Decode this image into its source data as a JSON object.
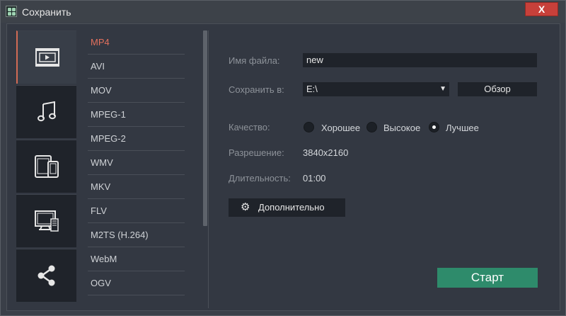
{
  "window": {
    "title": "Сохранить",
    "close_label": "X"
  },
  "categories": [
    {
      "name": "video",
      "icon": "film-icon",
      "active": true
    },
    {
      "name": "audio",
      "icon": "music-note-icon",
      "active": false
    },
    {
      "name": "devices",
      "icon": "tablet-phone-icon",
      "active": false
    },
    {
      "name": "tv",
      "icon": "tv-icon",
      "active": false
    },
    {
      "name": "share",
      "icon": "share-icon",
      "active": false
    }
  ],
  "formats": [
    "MP4",
    "AVI",
    "MOV",
    "MPEG-1",
    "MPEG-2",
    "WMV",
    "MKV",
    "FLV",
    "M2TS (H.264)",
    "WebM",
    "OGV"
  ],
  "selected_format": "MP4",
  "colors": {
    "accent": "#d26b55",
    "start": "#2e8b6b",
    "panel": "#333842",
    "sidebar": "#1f232a"
  },
  "form": {
    "filename_label": "Имя файла:",
    "filename_value": "new",
    "save_label": "Сохранить в:",
    "save_value": "E:\\",
    "browse_label": "Обзор",
    "quality_label": "Качество:",
    "quality_options": [
      "Хорошее",
      "Высокое",
      "Лучшее"
    ],
    "quality_selected": "Лучшее",
    "resolution_label": "Разрешение:",
    "resolution_value": "3840x2160",
    "duration_label": "Длительность:",
    "duration_value": "01:00",
    "advanced_label": "Дополнительно",
    "start_label": "Старт"
  }
}
